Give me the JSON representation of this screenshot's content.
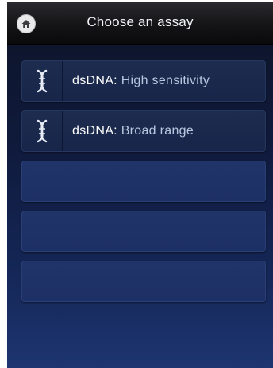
{
  "header": {
    "title": "Choose an assay",
    "home_icon": "home-icon"
  },
  "assays": [
    {
      "name": "dsDNA:",
      "variant": "High sensitivity",
      "icon": "dna-helix-icon"
    },
    {
      "name": "dsDNA:",
      "variant": "Broad range",
      "icon": "dna-helix-icon"
    }
  ],
  "empty_slots": 3,
  "colors": {
    "background_top": "#0e1428",
    "background_bottom": "#1d3570",
    "item": "#1d2c4e",
    "empty_item": "#203469",
    "label_primary": "#ffffff",
    "label_secondary": "#b8c7df"
  }
}
